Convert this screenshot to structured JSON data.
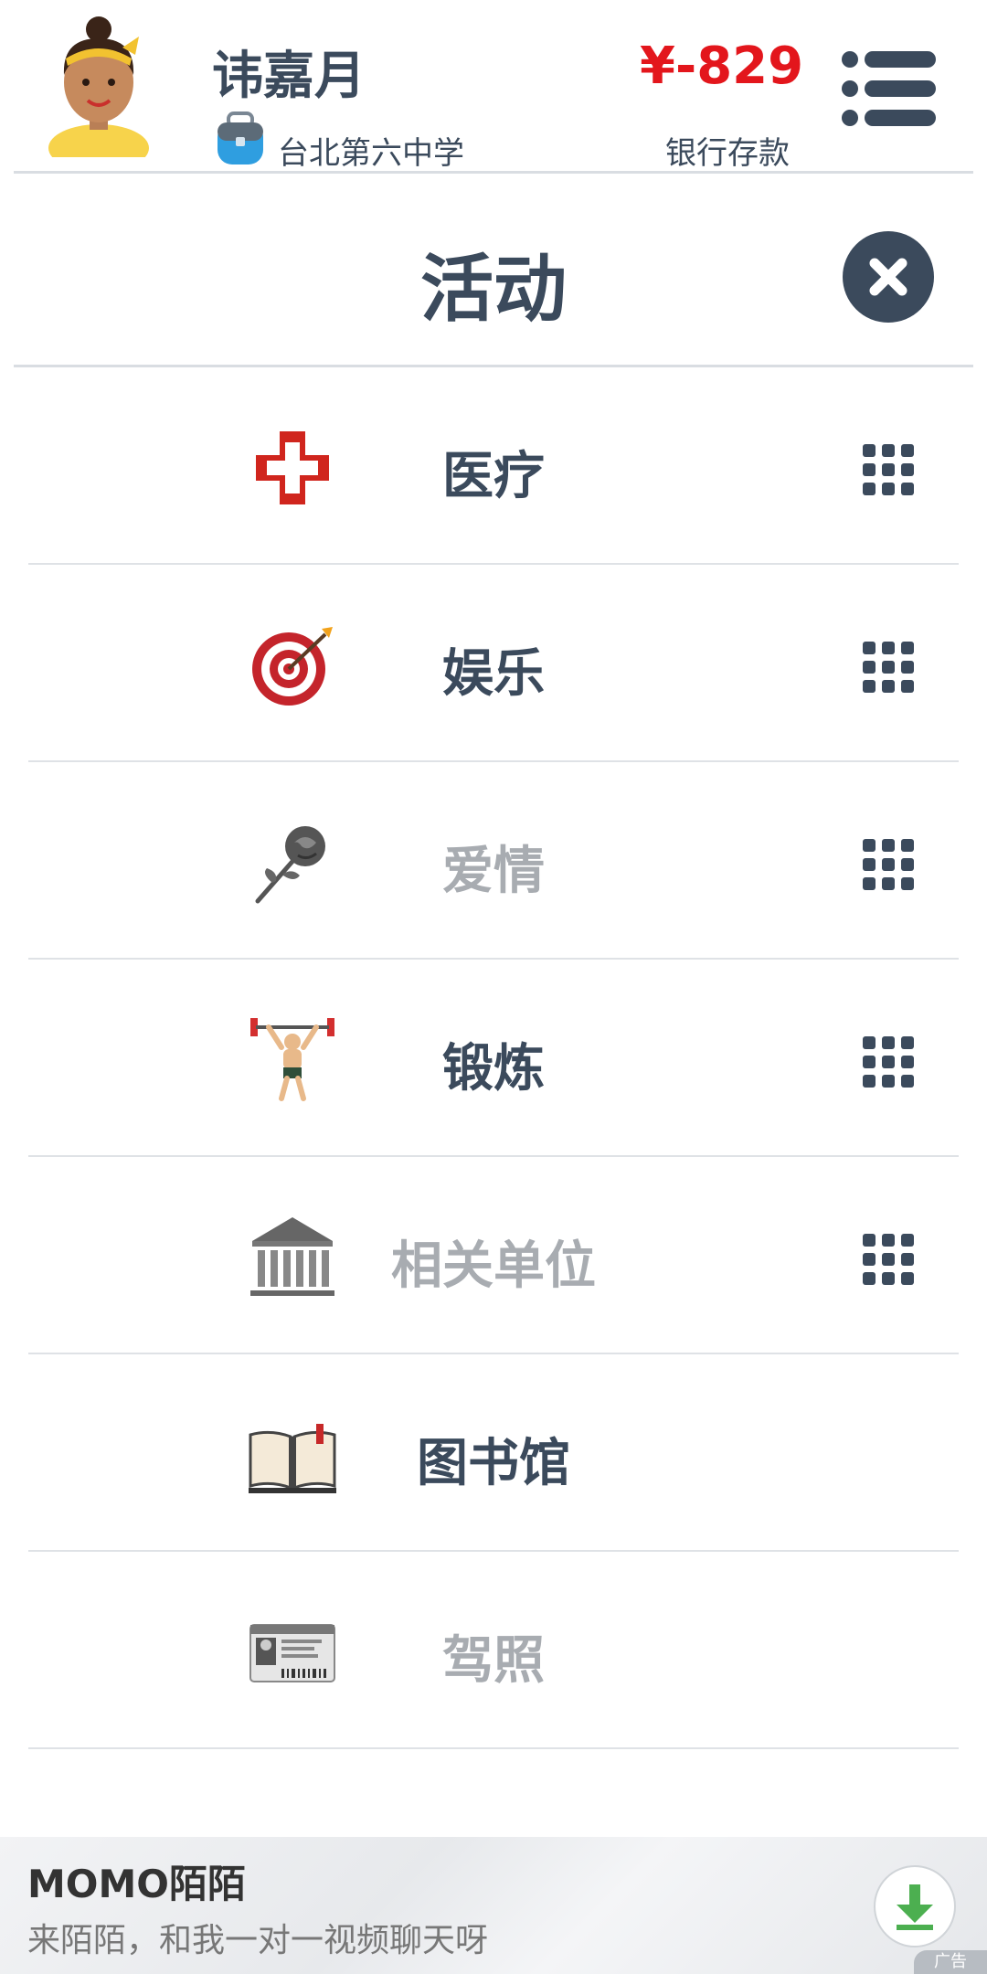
{
  "header": {
    "user_name": "讳嘉月",
    "school": "台北第六中学",
    "balance": "¥-829",
    "balance_label": "银行存款"
  },
  "title": "活动",
  "activities": [
    {
      "label": "医疗",
      "icon": "medical-cross-icon",
      "enabled": true,
      "has_grid": true
    },
    {
      "label": "娱乐",
      "icon": "target-icon",
      "enabled": true,
      "has_grid": true
    },
    {
      "label": "爱情",
      "icon": "rose-icon",
      "enabled": false,
      "has_grid": true
    },
    {
      "label": "锻炼",
      "icon": "weightlifter-icon",
      "enabled": true,
      "has_grid": true
    },
    {
      "label": "相关单位",
      "icon": "bank-icon",
      "enabled": false,
      "has_grid": true
    },
    {
      "label": "图书馆",
      "icon": "book-icon",
      "enabled": true,
      "has_grid": false
    },
    {
      "label": "驾照",
      "icon": "license-card-icon",
      "enabled": false,
      "has_grid": false
    }
  ],
  "ad": {
    "title": "MOMO陌陌",
    "description": "来陌陌，和我一对一视频聊天呀",
    "tag": "广告"
  },
  "colors": {
    "primary_text": "#3b4a5c",
    "balance_red": "#e3161c",
    "disabled_text": "#a8acb1",
    "download_green": "#4caf50"
  }
}
